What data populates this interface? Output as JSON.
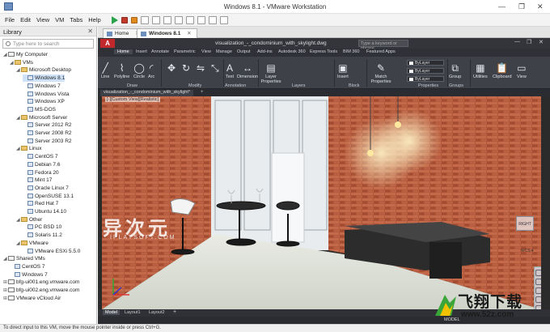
{
  "window": {
    "title": "Windows 8.1 - VMware Workstation",
    "controls": [
      "—",
      "❐",
      "✕"
    ]
  },
  "menu": [
    "File",
    "Edit",
    "View",
    "VM",
    "Tabs",
    "Help"
  ],
  "library": {
    "title": "Library",
    "close": "✕",
    "search_placeholder": "Type here to search",
    "tree": [
      {
        "label": "My Computer",
        "type": "pc",
        "level": 0,
        "exp": "◢"
      },
      {
        "label": "VMs",
        "type": "folder",
        "level": 1,
        "exp": "◢"
      },
      {
        "label": "Microsoft Desktop",
        "type": "folder",
        "level": 2,
        "exp": "◢"
      },
      {
        "label": "Windows 8.1",
        "type": "vm",
        "level": 3,
        "selected": true
      },
      {
        "label": "Windows 7",
        "type": "vm",
        "level": 3
      },
      {
        "label": "Windows Vista",
        "type": "vm",
        "level": 3
      },
      {
        "label": "Windows XP",
        "type": "vm",
        "level": 3
      },
      {
        "label": "MS-DOS",
        "type": "vm",
        "level": 3
      },
      {
        "label": "Microsoft Server",
        "type": "folder",
        "level": 2,
        "exp": "◢"
      },
      {
        "label": "Server 2012 R2",
        "type": "vm",
        "level": 3
      },
      {
        "label": "Server 2008 R2",
        "type": "vm",
        "level": 3
      },
      {
        "label": "Server 2003 R2",
        "type": "vm",
        "level": 3
      },
      {
        "label": "Linux",
        "type": "folder",
        "level": 2,
        "exp": "◢"
      },
      {
        "label": "CentOS 7",
        "type": "vm",
        "level": 3
      },
      {
        "label": "Debian 7.6",
        "type": "vm",
        "level": 3
      },
      {
        "label": "Fedora 20",
        "type": "vm",
        "level": 3
      },
      {
        "label": "Mint 17",
        "type": "vm",
        "level": 3
      },
      {
        "label": "Oracle Linux 7",
        "type": "vm",
        "level": 3
      },
      {
        "label": "OpenSUSE 13.1",
        "type": "vm",
        "level": 3
      },
      {
        "label": "Red Hat 7",
        "type": "vm",
        "level": 3
      },
      {
        "label": "Ubuntu 14.10",
        "type": "vm",
        "level": 3
      },
      {
        "label": "Other",
        "type": "folder",
        "level": 2,
        "exp": "◢"
      },
      {
        "label": "PC BSD 10",
        "type": "vm",
        "level": 3
      },
      {
        "label": "Solaris 11.2",
        "type": "vm",
        "level": 3
      },
      {
        "label": "VMware",
        "type": "folder",
        "level": 2,
        "exp": "◢"
      },
      {
        "label": "VMware ESXi 5.5.0",
        "type": "vm",
        "level": 3
      },
      {
        "label": "Shared VMs",
        "type": "pc",
        "level": 0,
        "exp": "◢"
      },
      {
        "label": "CentOS 7",
        "type": "vm",
        "level": 1
      },
      {
        "label": "Windows 7",
        "type": "vm",
        "level": 1
      },
      {
        "label": "bfg-ui001.eng.vmware.com",
        "type": "pc",
        "level": 0,
        "exp": "⊞"
      },
      {
        "label": "bfg-ui002.eng.vmware.com",
        "type": "pc",
        "level": 0,
        "exp": "⊞"
      },
      {
        "label": "VMware vCloud Air",
        "type": "pc",
        "level": 0,
        "exp": "⊞"
      }
    ]
  },
  "vm_tabs": [
    {
      "label": "Home",
      "active": false
    },
    {
      "label": "Windows 8.1",
      "active": true
    }
  ],
  "tab_close": "✕",
  "autocad": {
    "logo": "A",
    "file": "visualization_-_condominium_with_skylight.dwg",
    "search_placeholder": "Type a keyword or phrase",
    "ribbon_tabs": [
      "Home",
      "Insert",
      "Annotate",
      "Parametric",
      "View",
      "Manage",
      "Output",
      "Add-ins",
      "Autodesk 360",
      "Express Tools",
      "BIM 360",
      "Featured Apps"
    ],
    "tools": [
      "Line",
      "Polyline",
      "Circle",
      "Arc",
      "Text",
      "Dimension",
      "Layer Properties",
      "Insert",
      "Match Properties",
      "Group",
      "Utilities",
      "Clipboard",
      "View"
    ],
    "panels": [
      "Draw",
      "Modify",
      "Annotation",
      "Layers",
      "Block",
      "Properties",
      "Groups"
    ],
    "bylayer": [
      "ByLayer",
      "ByLayer",
      "ByLayer"
    ],
    "doc_tab": "visualization_-_condominium_with_skylight*",
    "doc_tab_plus": "+",
    "viewport_label": "[-][Custom View][Realistic]",
    "layout_tabs": [
      "Model",
      "Layout1",
      "Layout2"
    ],
    "layout_plus": "+",
    "model_label": "MODEL",
    "viewcube": "RIGHT",
    "wcs": "WCS ▾"
  },
  "status": "To direct input to this VM, move the mouse pointer inside or press Ctrl+G.",
  "watermarks": {
    "w1_main": "异次元",
    "w1_sub": "IPLAYSOFT.COM",
    "w2_main": "飞翔下载",
    "w2_url": "www.52z.com"
  }
}
